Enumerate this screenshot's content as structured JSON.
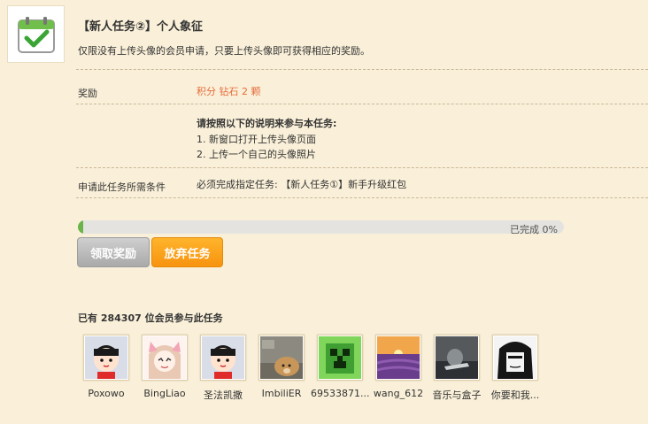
{
  "task": {
    "title": "【新人任务②】个人象征",
    "description": "仅限没有上传头像的会员申请，只要上传头像即可获得相应的奖励。"
  },
  "reward": {
    "label": "奖励",
    "value": "积分 钻石 2 颗"
  },
  "instructions": {
    "title": "请按照以下的说明来参与本任务:",
    "steps": [
      "1. 新窗口打开上传头像页面",
      "2. 上传一个自己的头像照片"
    ]
  },
  "requirement": {
    "label": "申请此任务所需条件",
    "value": "必须完成指定任务: 【新人任务①】新手升级红包"
  },
  "progress": {
    "percent": 0,
    "label": "已完成 0%"
  },
  "buttons": {
    "claim": "领取奖励",
    "abandon": "放弃任务"
  },
  "members": {
    "title": "已有 284307 位会员参与此任务",
    "list": [
      {
        "name": "Poxowo",
        "avatar": "default-boy-avatar"
      },
      {
        "name": "BingLiao",
        "avatar": "anime-girl-avatar"
      },
      {
        "name": "圣法凯撒",
        "avatar": "default-boy-avatar"
      },
      {
        "name": "ImbiliER",
        "avatar": "dog-photo-avatar"
      },
      {
        "name": "69533871...",
        "avatar": "creeper-avatar"
      },
      {
        "name": "wang_612",
        "avatar": "sunset-lavender-avatar"
      },
      {
        "name": "音乐与盒子",
        "avatar": "dark-photo-avatar"
      },
      {
        "name": "你要和我...",
        "avatar": "manga-girl-avatar"
      }
    ]
  },
  "colors": {
    "background": "#faf0d9",
    "reward": "#e56b3a",
    "progress": "#6bb44a",
    "abandon_button": "#f7930f"
  }
}
